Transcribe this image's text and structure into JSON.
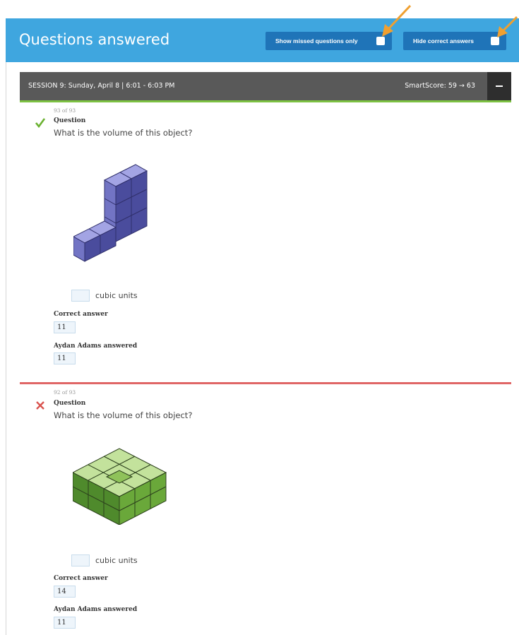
{
  "header": {
    "title": "Questions answered",
    "show_missed_label": "Show missed questions only",
    "hide_correct_label": "Hide correct answers",
    "accent": "#3fa6df",
    "button_color": "#1f74b8",
    "arrow_color": "#f0a030"
  },
  "session": {
    "label": "SESSION 9: Sunday, April 8 | 6:01 - 6:03 PM",
    "smartscore": "SmartScore: 59 → 63",
    "toggle_icon": "minus-icon"
  },
  "questions": [
    {
      "count": "93 of 93",
      "status": "correct",
      "status_icon": "checkmark-icon",
      "label": "Question",
      "text": "What is the volume of this object?",
      "units": "cubic units",
      "correct_label": "Correct answer",
      "correct_value": "11",
      "student_label": "Aydan Adams answered",
      "student_value": "11",
      "figure": "purple-cube-stack",
      "figure_color": "#6f70c0"
    },
    {
      "count": "92 of 93",
      "status": "incorrect",
      "status_icon": "x-mark-icon",
      "label": "Question",
      "text": "What is the volume of this object?",
      "units": "cubic units",
      "correct_label": "Correct answer",
      "correct_value": "14",
      "student_label": "Aydan Adams answered",
      "student_value": "11",
      "figure": "green-cube-stack",
      "figure_color": "#7cb84a"
    }
  ]
}
